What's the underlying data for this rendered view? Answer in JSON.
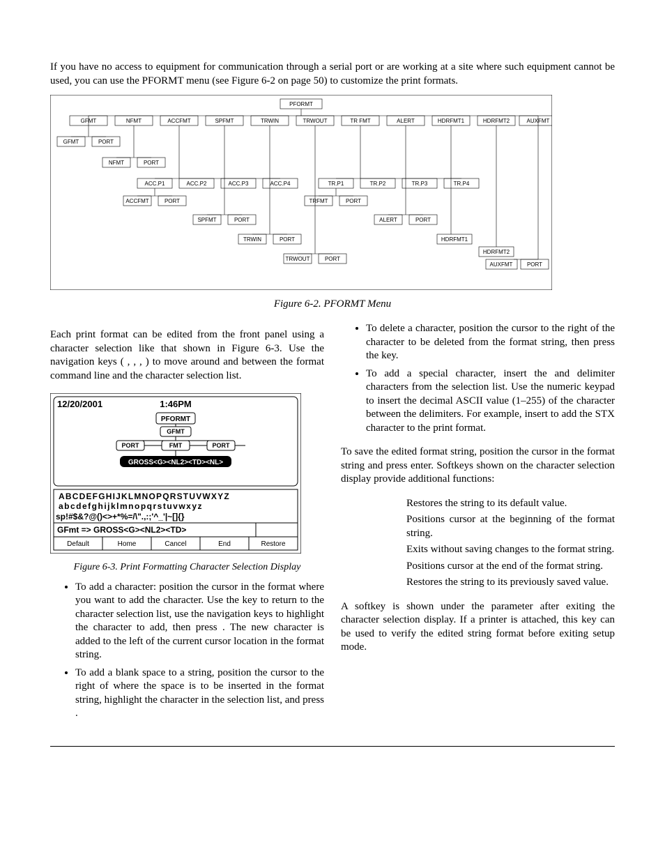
{
  "intro": "If you have no access to equipment for communication through a serial port or are working at a site where such equipment cannot be used, you can use the PFORMT menu (see Figure 6-2 on page 50) to customize the print formats.",
  "menu": {
    "root": "PFORMT",
    "row1": [
      "GFMT",
      "NFMT",
      "ACCFMT",
      "SPFMT",
      "TRWIN",
      "TRWOUT",
      "TR FMT",
      "ALERT",
      "HDRFMT1",
      "HDRFMT2",
      "AUXFMT"
    ],
    "row2": [
      "GFMT",
      "PORT"
    ],
    "sub2": [
      "NFMT",
      "PORT"
    ],
    "row3": [
      "ACC.P1",
      "ACC.P2",
      "ACC.P3",
      "ACC.P4"
    ],
    "sub3": [
      "ACCFMT",
      "PORT"
    ],
    "row4": [
      "SPFMT",
      "PORT"
    ],
    "row5": [
      "TRWIN",
      "PORT"
    ],
    "row6": [
      "TRWOUT",
      "PORT"
    ],
    "row7": [
      "TR.P1",
      "TR.P2",
      "TR.P3",
      "TR.P4"
    ],
    "sub7": [
      "TRFMT",
      "PORT"
    ],
    "row8": [
      "ALERT",
      "PORT"
    ],
    "row9": [
      "HDRFMT1"
    ],
    "row10": [
      "HDRFMT2"
    ],
    "row11": [
      "AUXFMT",
      "PORT"
    ],
    "caption": "Figure 6-2. PFORMT Menu"
  },
  "chsel": {
    "date": "12/20/2001",
    "time": "1:46PM",
    "menu": [
      "PFORMT",
      "GFMT",
      "FMT"
    ],
    "port_left": "PORT",
    "port_right": "PORT",
    "fmtstring": "GROSS<G><NL2><TD><NL>",
    "rows": [
      "ABCDEFGHIJKLMNOPQRSTUVWXYZ",
      "abcdefghijklmnopqrstuvwxyz",
      "sp!#$&?@()<>+*%=/\\\".,:;'^_'|~[]{}"
    ],
    "cmdline": "GFmt => GROSS<G><NL2><TD>",
    "softkeys": [
      "Default",
      "Home",
      "Cancel",
      "End",
      "Restore"
    ],
    "caption": "Figure 6-3. Print Formatting Character Selection Display"
  },
  "left": {
    "para1": "Each print format can be edited from the front panel using a character selection like that shown in Figure 6-3. Use the navigation keys (     ,        ,       ,       ) to move around and between the format command line and the character selection list.",
    "bul1": "To add a character: position the cursor in the format where you want to add the character. Use the        key to return to the character selection list, use the navigation keys to highlight the character to add, then press        . The new character is added to the left of the current cursor location in the format string.",
    "bul2": "To add a blank space to a string, position the cursor to the right of where the space is to be inserted in the format string, highlight the       character in the selection list, and press        ."
  },
  "right": {
    "bul3": "To delete a character, position the cursor to the right of the character to be deleted from the format string, then press the         key.",
    "bul4": "To add a special character, insert the      and     delimiter characters from the selection list. Use the numeric keypad to insert the decimal ASCII value (1–255) of the character between the delimiters. For example, insert          to add the STX character to the print format.",
    "para2": "To save the edited format string, position the cursor in the format string and press enter. Softkeys shown on the character selection display provide additional functions:",
    "softkeys": [
      {
        "label": "",
        "desc": "Restores the string to its default value."
      },
      {
        "label": "",
        "desc": "Positions cursor at the beginning of the format string."
      },
      {
        "label": "",
        "desc": "Exits without saving changes to the format string."
      },
      {
        "label": "",
        "desc": "Positions cursor at the end of the format string."
      },
      {
        "label": "",
        "desc": "Restores the string to its previously saved value."
      }
    ],
    "para3": "A              softkey is shown under the            parameter after exiting the character selection display. If a printer is attached, this key can be used to verify the edited string format before exiting setup mode."
  }
}
